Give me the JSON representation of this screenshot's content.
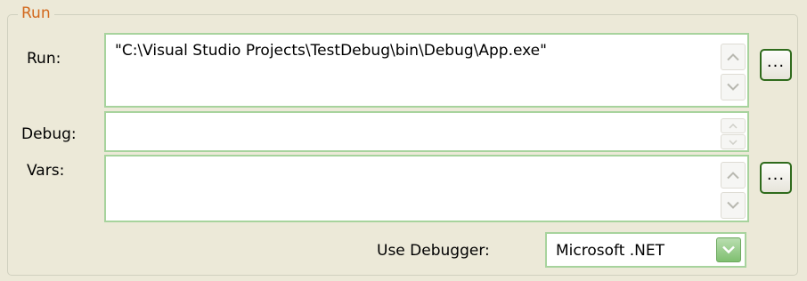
{
  "group": {
    "title": "Run"
  },
  "run": {
    "label": "Run:",
    "value": "\"C:\\Visual Studio Projects\\TestDebug\\bin\\Debug\\App.exe\"",
    "browse_label": "..."
  },
  "debug": {
    "label": "Debug:",
    "value": ""
  },
  "vars": {
    "label": "Vars:",
    "value": "",
    "browse_label": "..."
  },
  "debugger": {
    "label": "Use Debugger:",
    "selected": "Microsoft .NET"
  },
  "colors": {
    "accent_title": "#d2691e",
    "field_border": "#a7d39d",
    "button_border": "#2f6b1c"
  }
}
